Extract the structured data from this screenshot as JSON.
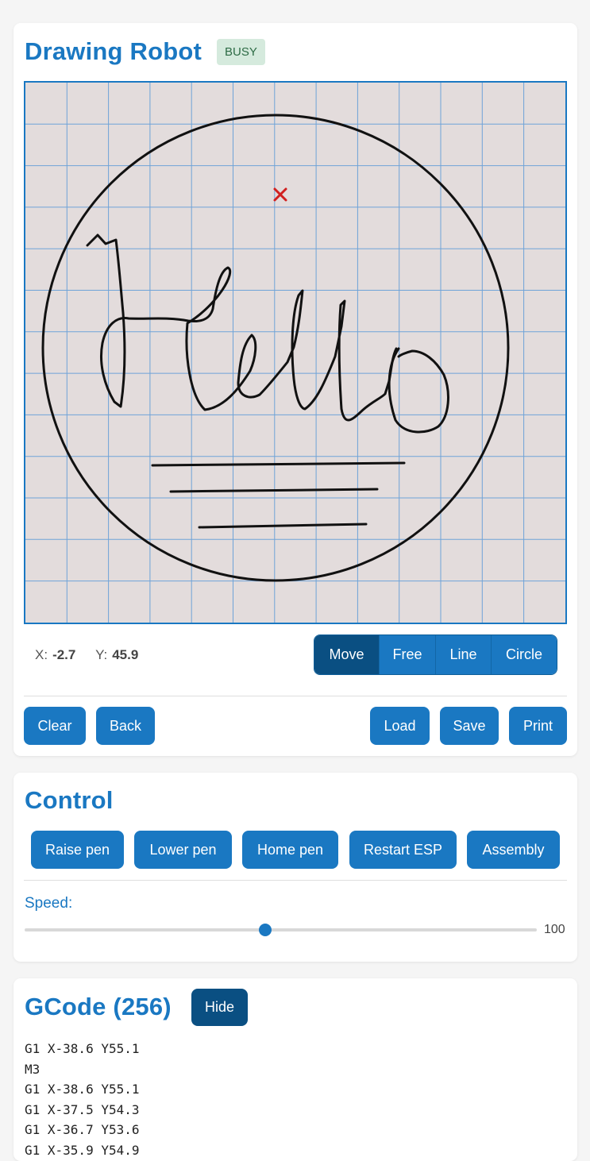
{
  "draw": {
    "title": "Drawing Robot",
    "status_badge": "BUSY",
    "coords": {
      "x_label": "X:",
      "x_value": "-2.7",
      "y_label": "Y:",
      "y_value": "45.9"
    },
    "modes": [
      "Move",
      "Free",
      "Line",
      "Circle"
    ],
    "active_mode": "Move",
    "actions_left": [
      "Clear",
      "Back"
    ],
    "actions_right": [
      "Load",
      "Save",
      "Print"
    ]
  },
  "control": {
    "title": "Control",
    "buttons": [
      "Raise pen",
      "Lower pen",
      "Home pen",
      "Restart ESP",
      "Assembly"
    ],
    "speed_label": "Speed:",
    "speed_value": "100",
    "speed_fraction": 0.47
  },
  "gcode": {
    "title": "GCode (256)",
    "hide_label": "Hide",
    "lines": [
      "G1 X-38.6 Y55.1",
      "M3",
      "G1 X-38.6 Y55.1",
      "G1 X-37.5 Y54.3",
      "G1 X-36.7 Y53.6",
      "G1 X-35.9 Y54.9"
    ]
  },
  "colors": {
    "accent": "#1a78c2",
    "accent_dark": "#0a4f82",
    "canvas_bg": "#e3dcdc",
    "grid": "#6fa3d8",
    "marker": "#d11f1f",
    "badge_bg": "#d5eadd"
  },
  "icons": {
    "position_marker": "close-x-icon"
  }
}
